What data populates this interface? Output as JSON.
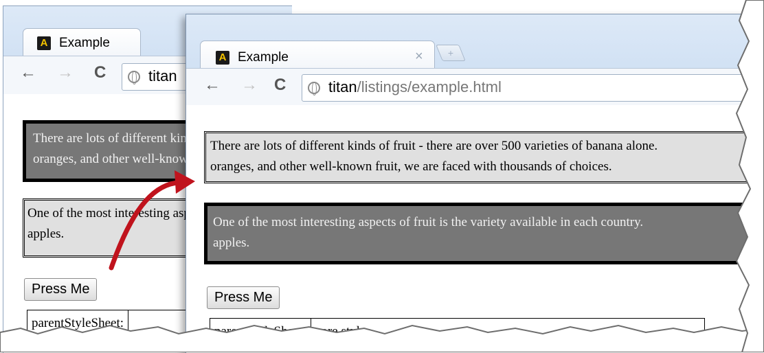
{
  "back_window": {
    "tab": {
      "title": "Example"
    },
    "toolbar": {
      "back": "←",
      "forward": "→",
      "reload": "C",
      "url_host": "titan",
      "url_path": ""
    },
    "paragraphs": [
      {
        "text": "There are lots of different kinds of fruit - there are over 500 varieties of banana alone. By the time we add the countless types of apples,",
        "text2": "oranges, and other well-known fruit, we are faced with thousands of choices."
      },
      {
        "text": "One of the most interesting aspects of fruit is the variety available in each country. I live near London, in an area which is known for its",
        "text2": "apples."
      }
    ],
    "button": {
      "label": "Press Me"
    },
    "table": {
      "key": "parentStyleSheet:",
      "value": ""
    }
  },
  "front_window": {
    "tab": {
      "title": "Example",
      "close": "×",
      "new_tab": "+"
    },
    "toolbar": {
      "back": "←",
      "forward": "→",
      "reload": "C",
      "url_host": "titan",
      "url_path": "/listings/example.html"
    },
    "paragraphs": [
      {
        "text": "There are lots of different kinds of fruit - there are over 500 varieties of banana alone.",
        "text2": "oranges, and other well-known fruit, we are faced with thousands of choices."
      },
      {
        "text": "One of the most interesting aspects of fruit is the variety available in each country.",
        "text2": "apples."
      }
    ],
    "button": {
      "label": "Press Me"
    },
    "table": {
      "key": "parentStyleSheet:",
      "value": "core styles"
    }
  },
  "colors": {
    "arrow": "#c0131d",
    "dark_para_bg": "#777777",
    "light_para_bg": "#e0e0e0"
  }
}
